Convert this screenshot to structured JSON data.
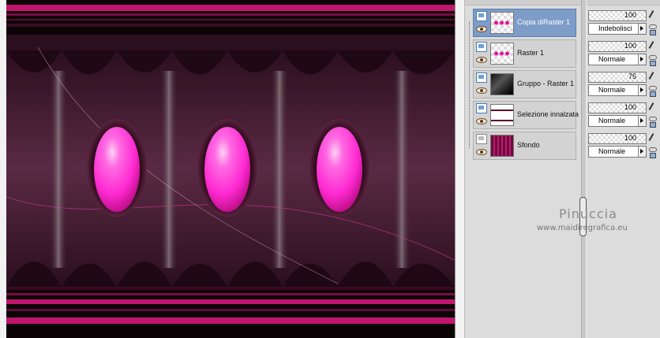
{
  "layers": [
    {
      "name": "Copia diRaster 1",
      "opacity": "100",
      "blend": "Indebolisci",
      "selected": true,
      "thumb": "dots"
    },
    {
      "name": "Raster 1",
      "opacity": "100",
      "blend": "Normale",
      "selected": false,
      "thumb": "dots"
    },
    {
      "name": "Gruppo - Raster 1",
      "opacity": "75",
      "blend": "Normale",
      "selected": false,
      "thumb": "gray"
    },
    {
      "name": "Selezione innalzata",
      "opacity": "100",
      "blend": "Normale",
      "selected": false,
      "thumb": "selection"
    },
    {
      "name": "Sfondo",
      "opacity": "100",
      "blend": "Normale",
      "selected": false,
      "thumb": "bars"
    }
  ],
  "watermark": {
    "name": "Pinuccia",
    "site": "www.maidiregrafica.eu"
  },
  "artwork": {
    "accent": "#ff3dd5",
    "background": "#4a1c33",
    "stripe": "#d01a78",
    "dark": "#14050c"
  }
}
